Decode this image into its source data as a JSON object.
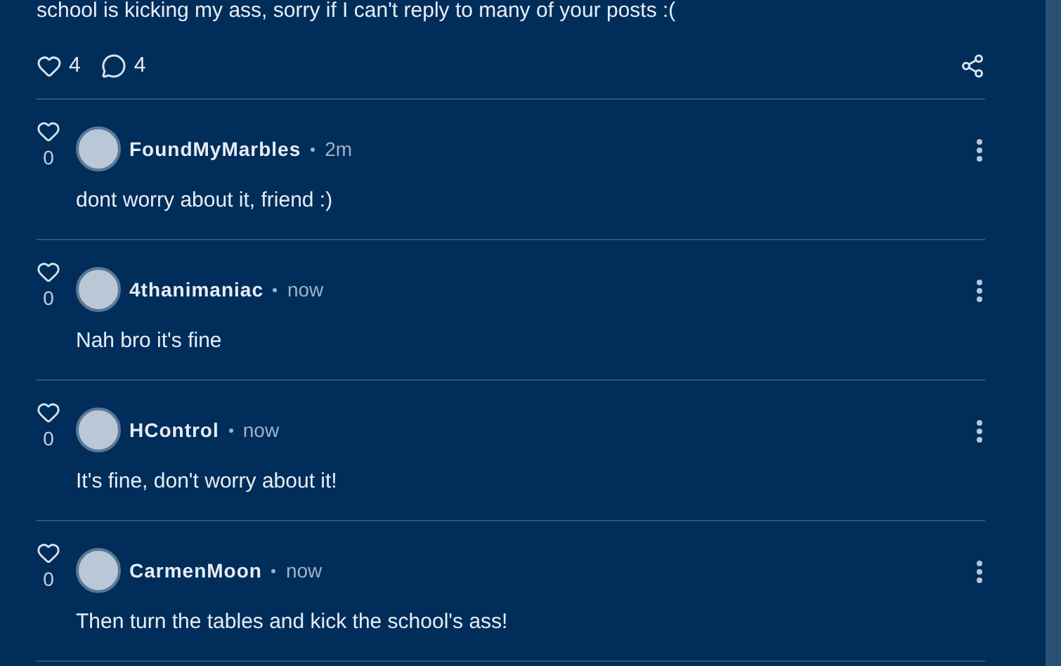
{
  "post": {
    "text": "school is kicking my ass, sorry if I can't reply to many of your posts :(",
    "likes": "4",
    "comments": "4"
  },
  "comments": [
    {
      "author": "FoundMyMarbles",
      "time": "2m",
      "likes": "0",
      "text": "dont worry about it, friend :)"
    },
    {
      "author": "4thanimaniac",
      "time": "now",
      "likes": "0",
      "text": "Nah bro it's fine"
    },
    {
      "author": "HControl",
      "time": "now",
      "likes": "0",
      "text": "It's fine, don't worry about it!"
    },
    {
      "author": "CarmenMoon",
      "time": "now",
      "likes": "0",
      "text": "Then turn the tables and kick the school's ass!"
    }
  ]
}
